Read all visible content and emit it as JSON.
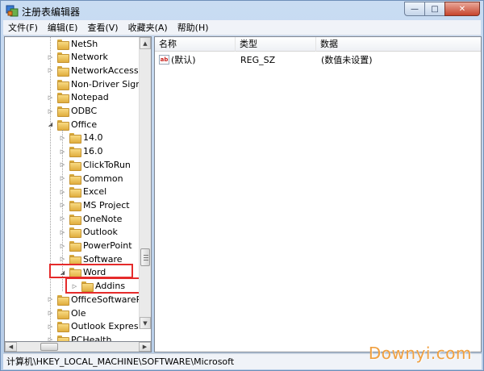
{
  "window": {
    "title": "注册表编辑器"
  },
  "caption": {
    "minimize": "—",
    "maximize": "□",
    "close": "✕"
  },
  "menu": [
    "文件(F)",
    "编辑(E)",
    "查看(V)",
    "收藏夹(A)",
    "帮助(H)"
  ],
  "tree": [
    {
      "label": "NetSh",
      "level": 0,
      "expander": "none"
    },
    {
      "label": "Network",
      "level": 0,
      "expander": "collapsed"
    },
    {
      "label": "NetworkAccessPr",
      "level": 0,
      "expander": "collapsed"
    },
    {
      "label": "Non-Driver Signin",
      "level": 0,
      "expander": "none"
    },
    {
      "label": "Notepad",
      "level": 0,
      "expander": "collapsed"
    },
    {
      "label": "ODBC",
      "level": 0,
      "expander": "collapsed"
    },
    {
      "label": "Office",
      "level": 0,
      "expander": "expanded"
    },
    {
      "label": "14.0",
      "level": 1,
      "expander": "collapsed"
    },
    {
      "label": "16.0",
      "level": 1,
      "expander": "collapsed"
    },
    {
      "label": "ClickToRun",
      "level": 1,
      "expander": "collapsed"
    },
    {
      "label": "Common",
      "level": 1,
      "expander": "collapsed"
    },
    {
      "label": "Excel",
      "level": 1,
      "expander": "collapsed"
    },
    {
      "label": "MS Project",
      "level": 1,
      "expander": "collapsed"
    },
    {
      "label": "OneNote",
      "level": 1,
      "expander": "collapsed"
    },
    {
      "label": "Outlook",
      "level": 1,
      "expander": "collapsed"
    },
    {
      "label": "PowerPoint",
      "level": 1,
      "expander": "collapsed"
    },
    {
      "label": "Software",
      "level": 1,
      "expander": "collapsed"
    },
    {
      "label": "Word",
      "level": 1,
      "expander": "expanded"
    },
    {
      "label": "Addins",
      "level": 2,
      "expander": "collapsed"
    },
    {
      "label": "OfficeSoftwarePro",
      "level": 0,
      "expander": "collapsed"
    },
    {
      "label": "Ole",
      "level": 0,
      "expander": "collapsed"
    },
    {
      "label": "Outlook Express",
      "level": 0,
      "expander": "collapsed"
    },
    {
      "label": "PCHealth",
      "level": 0,
      "expander": "collapsed"
    }
  ],
  "list": {
    "headers": {
      "name": "名称",
      "type": "类型",
      "data": "数据"
    },
    "rows": [
      {
        "icon": "ab",
        "name": "(默认)",
        "type": "REG_SZ",
        "data": "(数值未设置)"
      }
    ]
  },
  "status": {
    "path": "计算机\\HKEY_LOCAL_MACHINE\\SOFTWARE\\Microsoft"
  },
  "watermark": "Downyi.com",
  "colors": {
    "highlight_box": "#e52b2b",
    "watermark": "#f0a040"
  }
}
